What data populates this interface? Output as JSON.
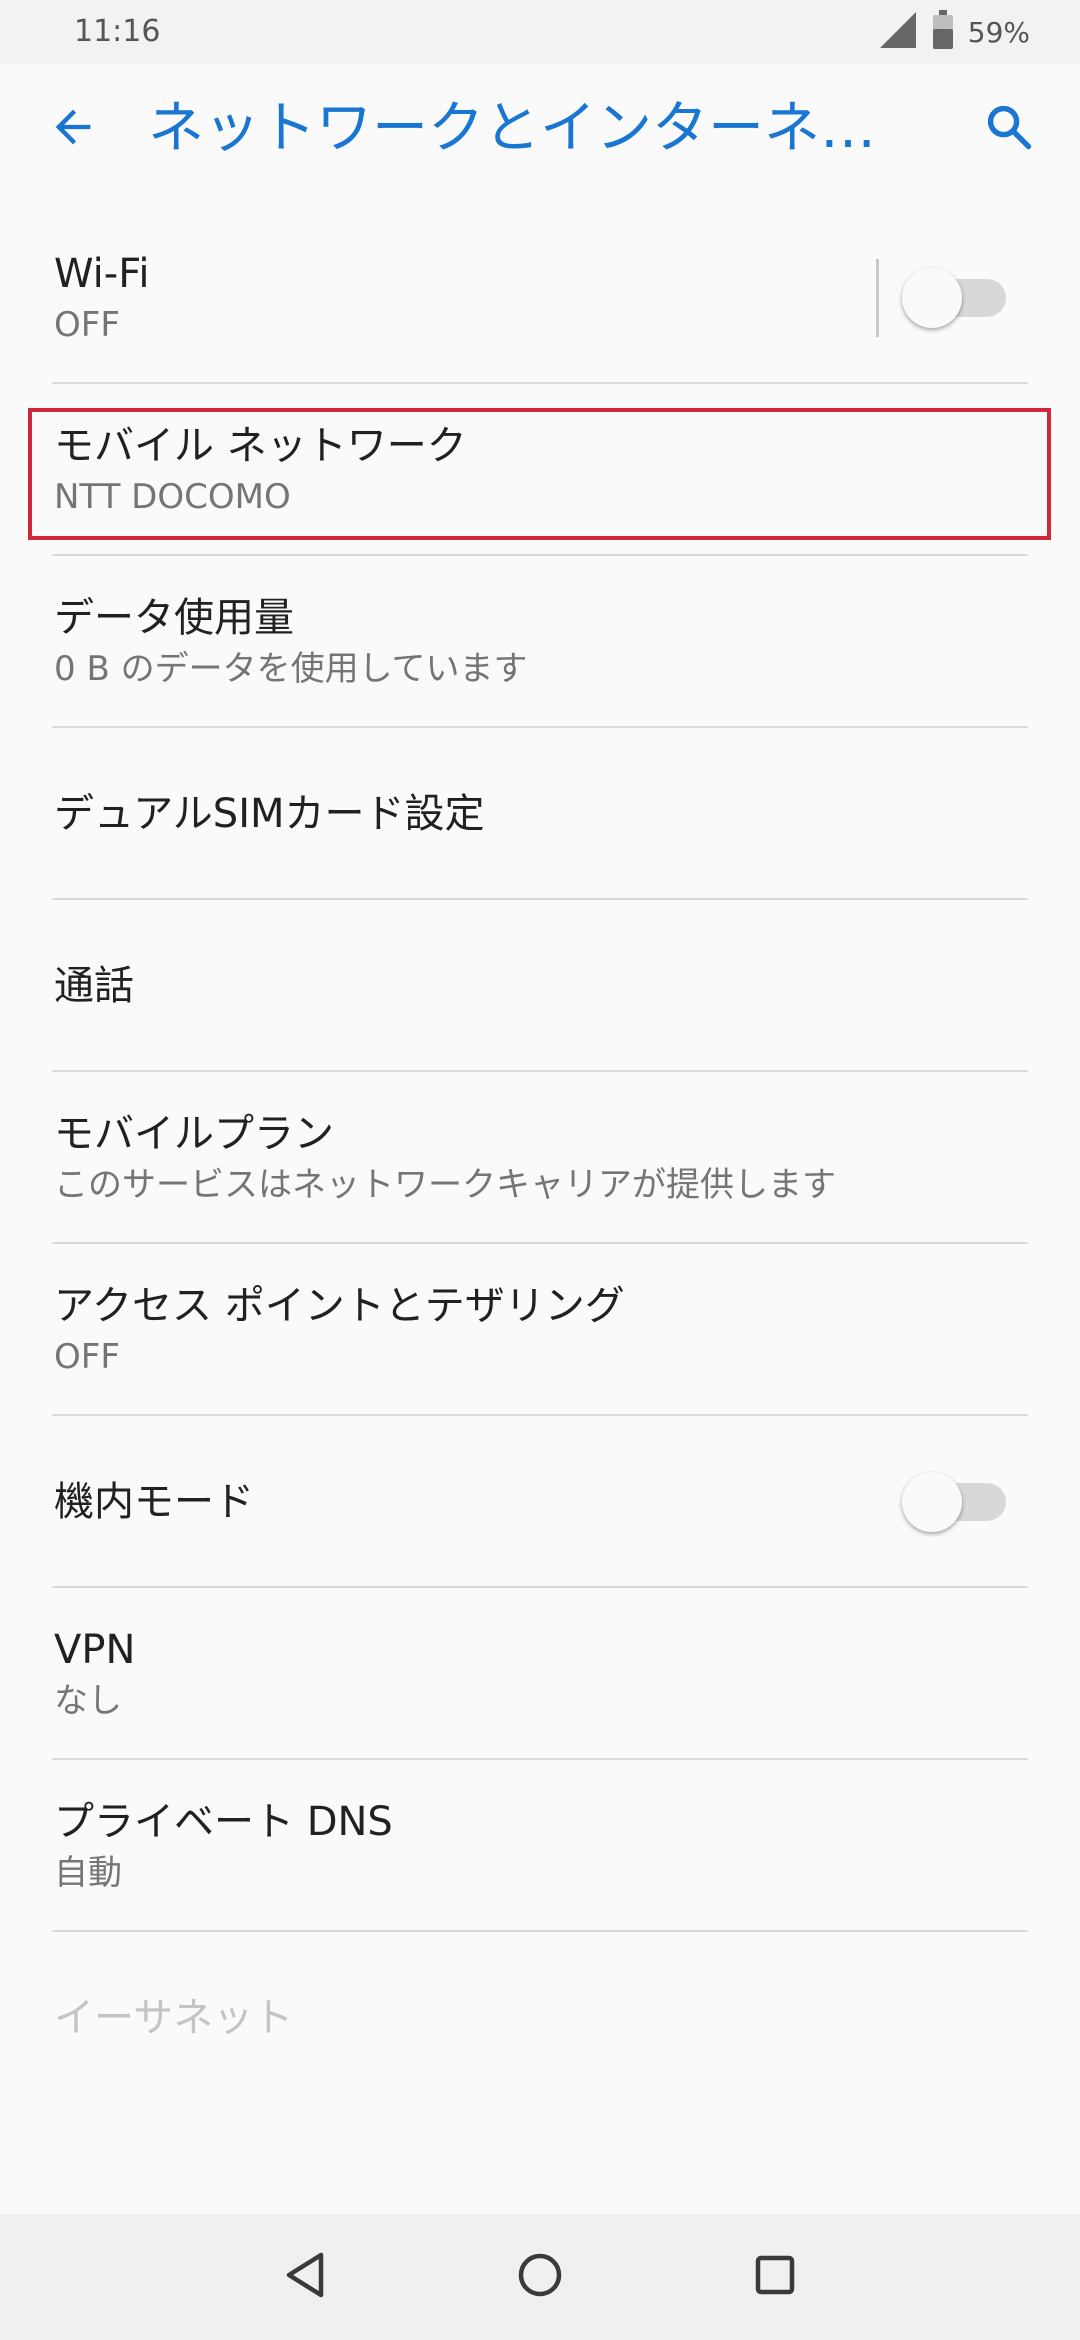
{
  "status_bar": {
    "time": "11:16",
    "battery": "59%",
    "icons": [
      "signal-icon",
      "battery-icon"
    ]
  },
  "app_bar": {
    "title": "ネットワークとインターネ…",
    "back_icon": "arrow-back-icon",
    "search_icon": "search-icon"
  },
  "items": [
    {
      "title": "Wi-Fi",
      "summary": "OFF",
      "has_switch": true,
      "switch_on": false
    },
    {
      "title": "モバイル ネットワーク",
      "summary": "NTT DOCOMO"
    },
    {
      "title": "データ使用量",
      "summary": "0 B のデータを使用しています"
    },
    {
      "title": "デュアルSIMカード設定"
    },
    {
      "title": "通話"
    },
    {
      "title": "モバイルプラン",
      "summary": "このサービスはネットワークキャリアが提供します"
    },
    {
      "title": "アクセス ポイントとテザリング",
      "summary": "OFF"
    },
    {
      "title": "機内モード",
      "has_switch": true,
      "switch_on": false
    },
    {
      "title": "VPN",
      "summary": "なし"
    },
    {
      "title": "プライベート DNS",
      "summary": "自動"
    },
    {
      "title": "イーサネット",
      "disabled": true
    }
  ],
  "highlight_target": "モバイル ネットワーク",
  "nav_bar": {
    "buttons": [
      "back-triangle-icon",
      "home-circle-icon",
      "recents-square-icon"
    ]
  },
  "colors": {
    "accent": "#1976d2",
    "highlight_border": "#d0283a",
    "background": "#fafafa"
  }
}
